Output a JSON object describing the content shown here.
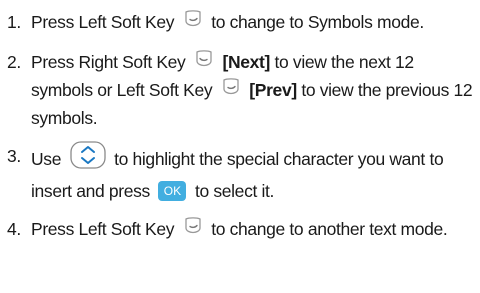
{
  "icons": {
    "left_soft_key": "left-soft-key-icon",
    "right_soft_key": "right-soft-key-icon",
    "navigation_key": "navigation-key-icon",
    "ok_key": "ok-key-icon"
  },
  "colors": {
    "ok_key": "#42aee0",
    "soft_key_stroke": "#999999",
    "nav_arrows": "#1a78c2"
  },
  "steps": [
    {
      "number": "1.",
      "a": "Press Left Soft Key",
      "b": "to change to Symbols mode."
    },
    {
      "number": "2.",
      "a": "Press Right Soft Key",
      "b_bold": "[Next]",
      "c": "to view the next 12 symbols or Left Soft Key",
      "d_bold": "[Prev]",
      "e": "to view the previous 12 symbols."
    },
    {
      "number": "3.",
      "a": "Use",
      "b": "to highlight the special character you want to insert and press",
      "ok_label": "OK",
      "c": "to select it."
    },
    {
      "number": "4.",
      "a": "Press Left Soft Key",
      "b": "to change to another text mode."
    }
  ]
}
